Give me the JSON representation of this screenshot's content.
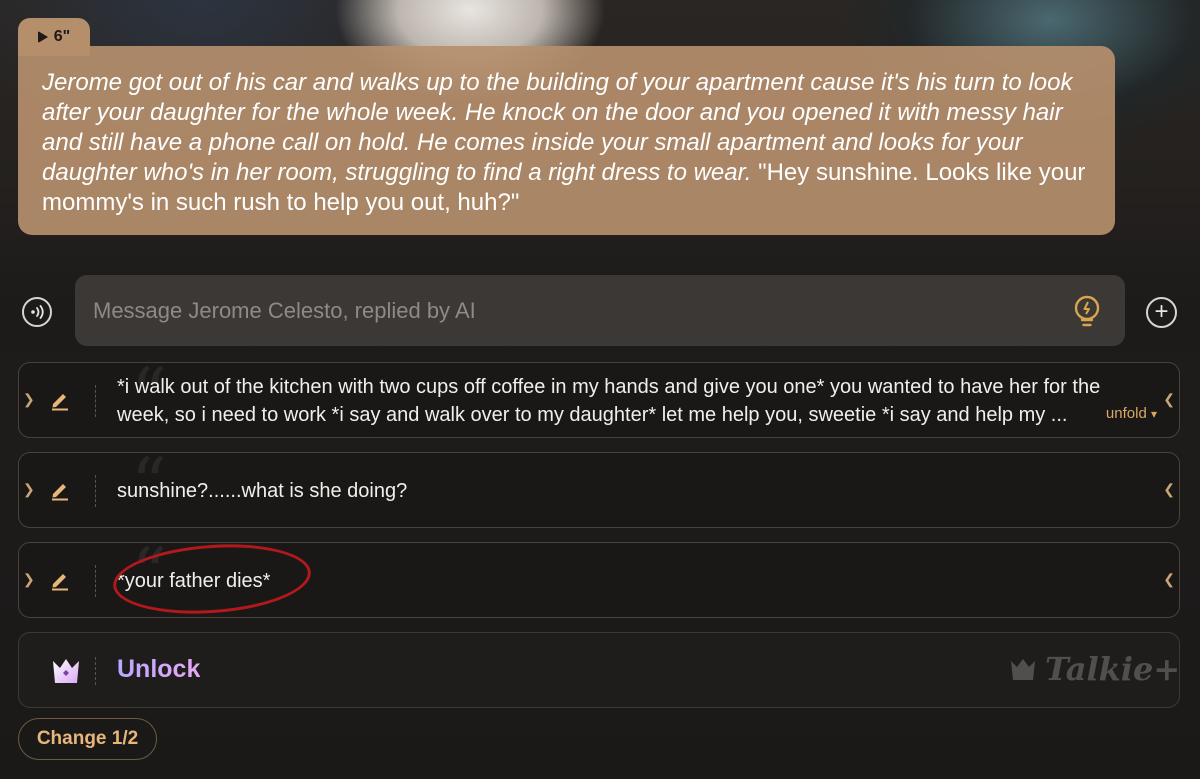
{
  "narration": {
    "duration": "6\"",
    "italic_text": "Jerome got out of his car and walks up to the building of your apartment cause it's his turn to look after your daughter for the whole week. He knock on the door and you opened it with messy hair and still have a phone call on hold. He comes inside your small apartment and looks for your daughter who's in her room, struggling to find a right dress to wear.",
    "speech_text": " \"Hey sunshine. Looks like your mommy's in such rush to help you out, huh?\""
  },
  "composer": {
    "placeholder": "Message Jerome Celesto, replied by AI"
  },
  "replies": [
    {
      "line1": "*i walk out of the kitchen with two cups off coffee in my hands and give you one* you wanted to have her for the",
      "line2": "week, so i need to work *i say and walk over to my daughter* let me help you, sweetie *i say and help my ...",
      "unfold_label": "unfold"
    },
    {
      "text": "sunshine?......what is she doing?"
    },
    {
      "text": "*your father dies*"
    }
  ],
  "unlock": {
    "label": "Unlock",
    "watermark": "Talkie+"
  },
  "change_button": {
    "label": "Change 1/2"
  },
  "colors": {
    "narration_bg": "#b58f6c",
    "accent_gold": "#e6b67a",
    "circle_mark": "#b3191c"
  }
}
